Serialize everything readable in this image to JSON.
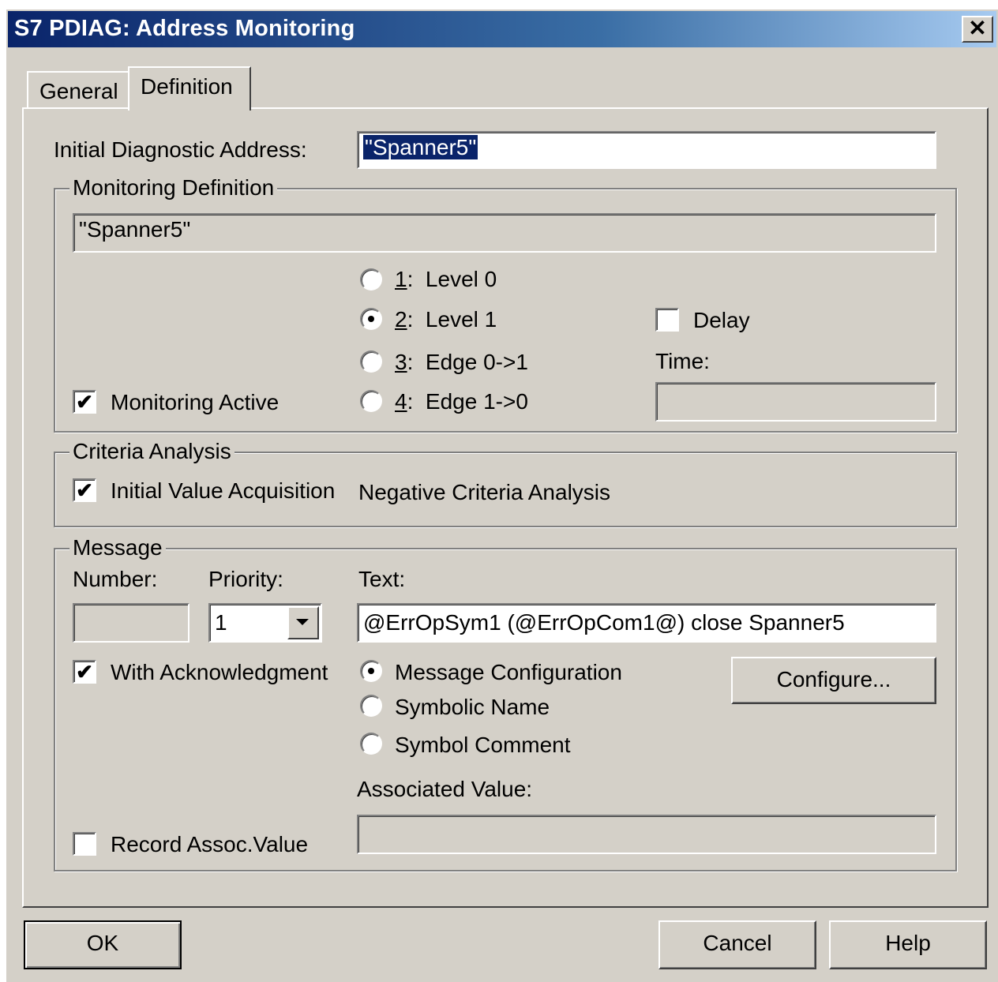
{
  "window": {
    "title": "S7 PDIAG: Address Monitoring",
    "close_glyph": "✕"
  },
  "tabs": [
    {
      "label": "General",
      "active": false
    },
    {
      "label": "Definition",
      "active": true
    }
  ],
  "initial_address": {
    "label": "Initial Diagnostic Address:",
    "value": "\"Spanner5\""
  },
  "monitoring": {
    "group_title": "Monitoring Definition",
    "expression": "\"Spanner5\"",
    "levels": [
      {
        "num": "1",
        "label": "Level 0",
        "selected": false
      },
      {
        "num": "2",
        "label": "Level 1",
        "selected": true
      },
      {
        "num": "3",
        "label": "Edge 0->1",
        "selected": false
      },
      {
        "num": "4",
        "label": "Edge 1->0",
        "selected": false
      }
    ],
    "monitoring_active_label": "Monitoring Active",
    "monitoring_active_checked": true,
    "delay_label": "Delay",
    "delay_checked": false,
    "time_label": "Time:",
    "time_value": ""
  },
  "criteria": {
    "group_title": "Criteria Analysis",
    "initial_value_label": "Initial Value Acquisition",
    "initial_value_checked": true,
    "negative_label": "Negative Criteria Analysis"
  },
  "message": {
    "group_title": "Message",
    "number_label": "Number:",
    "number_value": "",
    "priority_label": "Priority:",
    "priority_value": "1",
    "text_label": "Text:",
    "text_value": "@ErrOpSym1 (@ErrOpCom1@) close Spanner5",
    "with_ack_label": "With Acknowledgment",
    "with_ack_checked": true,
    "options": [
      {
        "label": "Message Configuration",
        "selected": true
      },
      {
        "label": "Symbolic Name",
        "selected": false
      },
      {
        "label": "Symbol Comment",
        "selected": false
      }
    ],
    "configure_label": "Configure...",
    "associated_value_label": "Associated Value:",
    "associated_value": "",
    "record_assoc_label": "Record Assoc.Value",
    "record_assoc_checked": false
  },
  "footer": {
    "ok_label": "OK",
    "cancel_label": "Cancel",
    "help_label": "Help"
  },
  "check_glyph": "✔"
}
